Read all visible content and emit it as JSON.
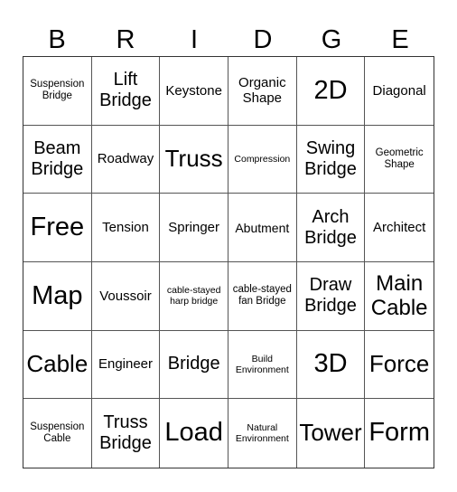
{
  "title_letters": [
    "B",
    "R",
    "I",
    "D",
    "G",
    "E"
  ],
  "cells": [
    {
      "text": "Suspension Bridge",
      "size": "s-s"
    },
    {
      "text": "Lift Bridge",
      "size": "s-l"
    },
    {
      "text": "Keystone",
      "size": "s-m"
    },
    {
      "text": "Organic Shape",
      "size": "s-m"
    },
    {
      "text": "2D",
      "size": "s-xl"
    },
    {
      "text": "Diagonal",
      "size": "s-m"
    },
    {
      "text": "Beam Bridge",
      "size": "s-l"
    },
    {
      "text": "Roadway",
      "size": "s-m"
    },
    {
      "text": "Truss",
      "size": "s-xl-small"
    },
    {
      "text": "Compression",
      "size": "s-xs"
    },
    {
      "text": "Swing Bridge",
      "size": "s-l"
    },
    {
      "text": "Geometric Shape",
      "size": "s-s"
    },
    {
      "text": "Free",
      "size": "s-xl"
    },
    {
      "text": "Tension",
      "size": "s-m"
    },
    {
      "text": "Springer",
      "size": "s-m"
    },
    {
      "text": "Abutment",
      "size": "s-m-small"
    },
    {
      "text": "Arch Bridge",
      "size": "s-l"
    },
    {
      "text": "Architect",
      "size": "s-m"
    },
    {
      "text": "Map",
      "size": "s-xl"
    },
    {
      "text": "Voussoir",
      "size": "s-m"
    },
    {
      "text": "cable-stayed harp bridge",
      "size": "s-xs"
    },
    {
      "text": "cable-stayed fan Bridge",
      "size": "s-s"
    },
    {
      "text": "Draw Bridge",
      "size": "s-l"
    },
    {
      "text": "Main Cable",
      "size": "s-l2"
    },
    {
      "text": "Cable",
      "size": "s-xl-mid"
    },
    {
      "text": "Engineer",
      "size": "s-m"
    },
    {
      "text": "Bridge",
      "size": "s-l"
    },
    {
      "text": "Build Environment",
      "size": "s-xs"
    },
    {
      "text": "3D",
      "size": "s-xl"
    },
    {
      "text": "Force",
      "size": "s-xl-mid"
    },
    {
      "text": "Suspension Cable",
      "size": "s-s"
    },
    {
      "text": "Truss Bridge",
      "size": "s-l"
    },
    {
      "text": "Load",
      "size": "s-xl"
    },
    {
      "text": "Natural Environment",
      "size": "s-xs"
    },
    {
      "text": "Tower",
      "size": "s-xl-mid"
    },
    {
      "text": "Form",
      "size": "s-xl"
    }
  ]
}
